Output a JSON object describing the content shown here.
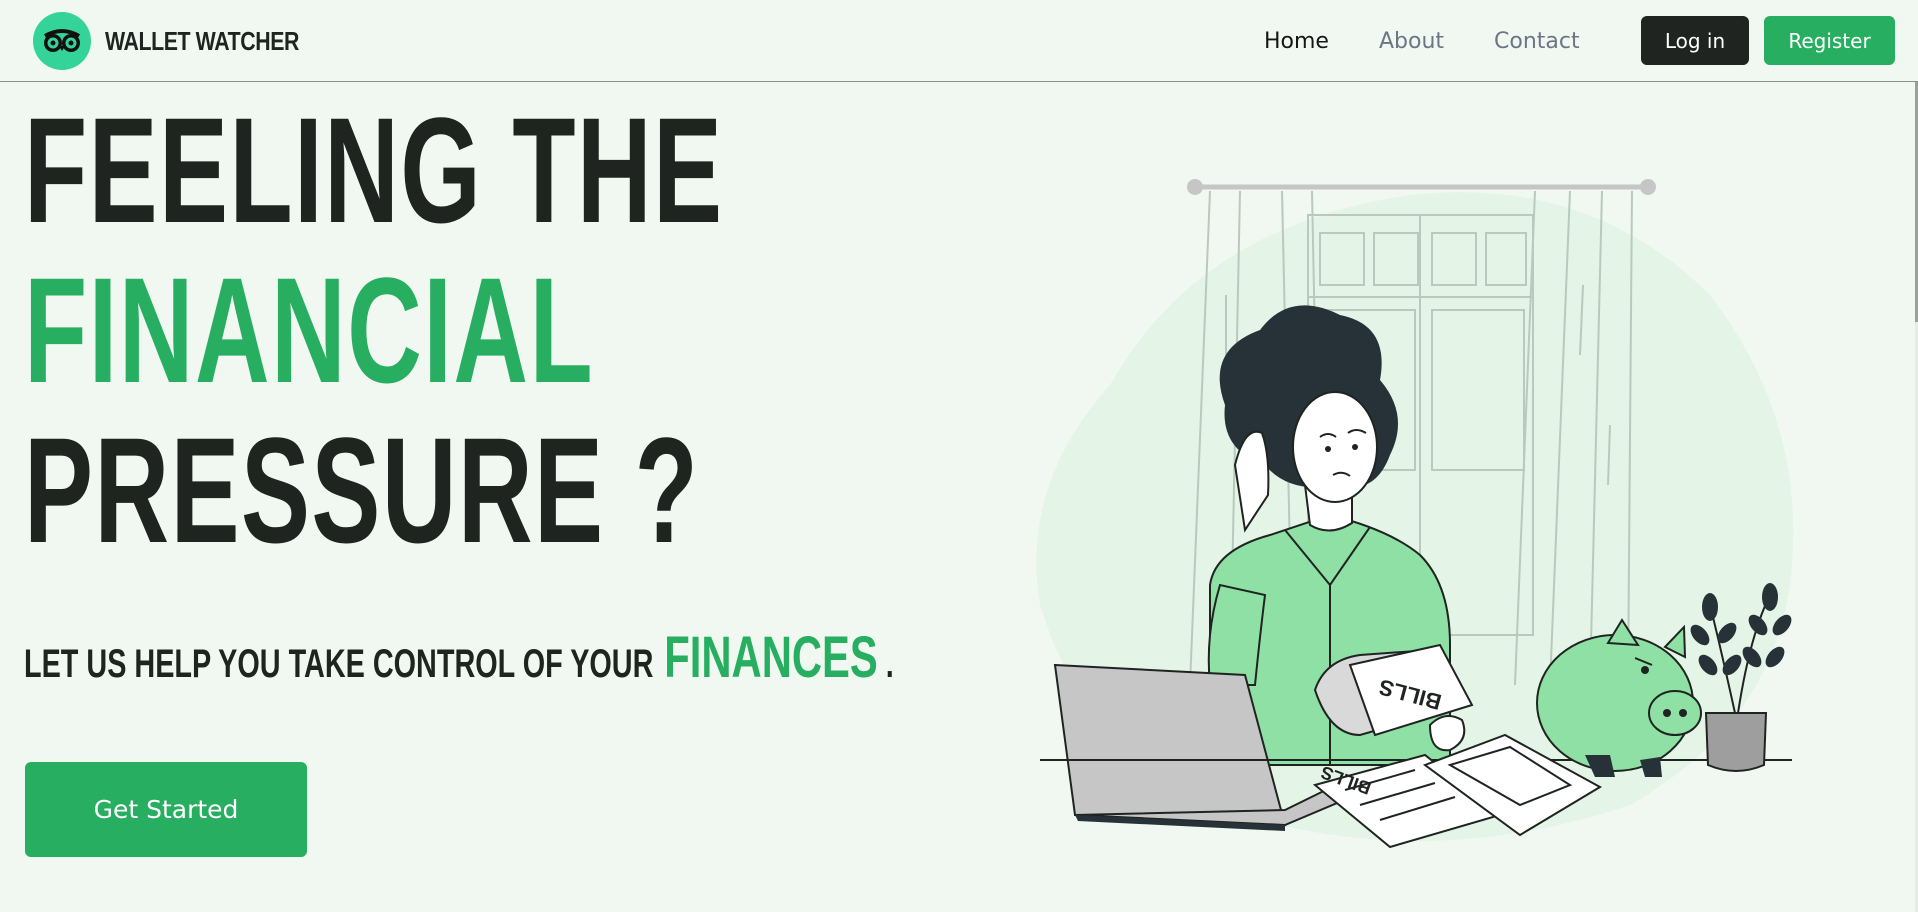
{
  "brand": {
    "name": "WALLET WATCHER",
    "logo_icon": "owl-icon"
  },
  "nav": {
    "links": [
      {
        "label": "Home",
        "active": true
      },
      {
        "label": "About",
        "active": false
      },
      {
        "label": "Contact",
        "active": false
      }
    ],
    "login_label": "Log in",
    "register_label": "Register"
  },
  "hero": {
    "headline_line1": "FEELING THE",
    "headline_line2": "FINANCIAL",
    "headline_line3": "PRESSURE ?",
    "subtitle_prefix": "LET US HELP YOU TAKE CONTROL OF YOUR",
    "subtitle_accent": "FINANCES",
    "subtitle_suffix": ".",
    "cta_label": "Get Started"
  },
  "illustration": {
    "bill_label": "BILLS",
    "paper_label": "BILLS",
    "icon": "stressed-woman-bills-illustration"
  },
  "colors": {
    "accent": "#27ae60",
    "dark": "#1f2421",
    "background": "#f1f8f1",
    "logo": "#34d399",
    "light_green": "#8fe0a5"
  }
}
